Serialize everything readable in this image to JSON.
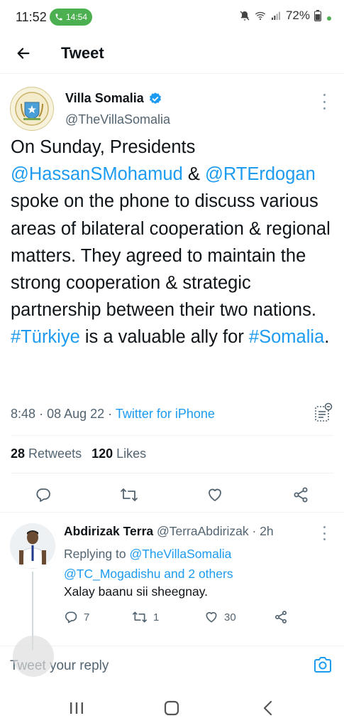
{
  "status_bar": {
    "time": "11:52",
    "call_time": "14:54",
    "battery": "72%"
  },
  "header": {
    "title": "Tweet"
  },
  "tweet": {
    "author_name": "Villa Somalia",
    "author_handle": "@TheVillaSomalia",
    "text_parts": {
      "p1": "On Sunday, Presidents ",
      "mention1": "@HassanSMohamud",
      "p2": " & ",
      "mention2": "@RTErdogan",
      "p3": " spoke on the phone to discuss various areas of bilateral cooperation & regional matters. They agreed to maintain the strong cooperation & strategic partnership between their two nations. ",
      "hashtag1": "#Türkiye",
      "p4": " is a valuable ally for ",
      "hashtag2": "#Somalia",
      "p5": "."
    },
    "time": "8:48",
    "date": "08 Aug 22",
    "source": "Twitter for iPhone",
    "retweets_count": "28",
    "retweets_label": "Retweets",
    "likes_count": "120",
    "likes_label": "Likes"
  },
  "reply": {
    "author_name": "Abdirizak Terra",
    "author_handle": "@TerraAbdirizak",
    "age": "2h",
    "replying_label": "Replying to",
    "replying_to": "@TheVillaSomalia",
    "replying_to_more": "@TC_Mogadishu and 2 others",
    "text": "Xalay baanu sii sheegnay.",
    "replies": "7",
    "retweets": "1",
    "likes": "30"
  },
  "compose": {
    "placeholder": "Tweet your reply"
  },
  "colors": {
    "accent": "#1d9bf0",
    "text": "#0f1419",
    "secondary": "#536471",
    "call_green": "#4caf50"
  }
}
